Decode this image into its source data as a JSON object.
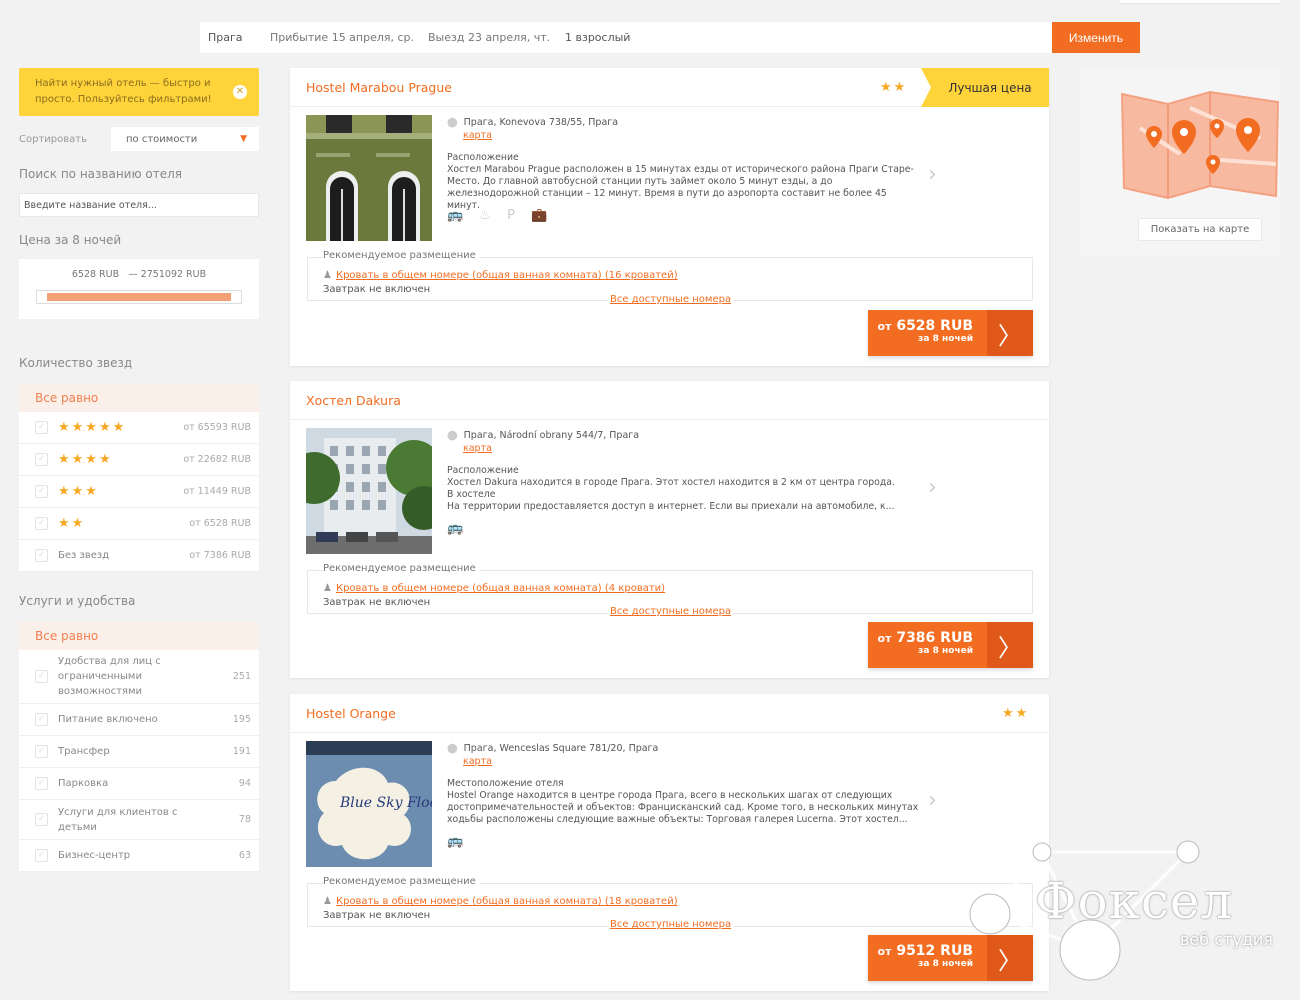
{
  "search": {
    "city": "Прага",
    "arrival": "Прибытие 15 апреля, ср.",
    "departure": "Выезд 23 апреля, чт.",
    "guests": "1 взрослый",
    "change_label": "Изменить"
  },
  "sidebar": {
    "hint": "Найти нужный отель — быстро и просто. Пользуйтесь фильтрами!",
    "hint_close": "✕",
    "sort_label": "Сортировать",
    "sort_value": "по стоимости",
    "name_search_title": "Поиск по названию отеля",
    "name_search_placeholder": "Введите название отеля...",
    "price_title": "Цена за 8 ночей",
    "price_min": "6528 RUB",
    "price_max": "— 2751092 RUB",
    "price_fill_fraction": 1.0,
    "stars_title": "Количество звезд",
    "stars_all": "Все равно",
    "stars_rows": [
      {
        "stars": "★★★★★",
        "value": "от 65593 RUB"
      },
      {
        "stars": "★★★★",
        "value": "от 22682 RUB"
      },
      {
        "stars": "★★★",
        "value": "от 11449 RUB"
      },
      {
        "stars": "★★",
        "value": "от 6528 RUB"
      },
      {
        "label": "Без звезд",
        "value": "от 7386 RUB"
      }
    ],
    "services_title": "Услуги и удобства",
    "services_all": "Все равно",
    "services": [
      {
        "label": "Удобства для лиц с ограниченными возможностями",
        "count": "251"
      },
      {
        "label": "Питание включено",
        "count": "195"
      },
      {
        "label": "Трансфер",
        "count": "191"
      },
      {
        "label": "Парковка",
        "count": "94"
      },
      {
        "label": "Услуги для клиентов с детьми",
        "count": "78"
      },
      {
        "label": "Бизнес-центр",
        "count": "63"
      }
    ]
  },
  "hotels": [
    {
      "name": "Hostel Marabou Prague",
      "stars": "★★",
      "badge": "Лучшая цена",
      "address": "Прага, Konevova 738/55, Прага",
      "map_link": "карта",
      "desc_title": "Расположение",
      "desc": "Хостел Marabou Prague расположен в 15 минутах езды от исторического района Праги Старе-Место. До главной автобусной станции путь займет около 5 минут езды, а до железнодорожной станции – 12 минут. Время в пути до аэропорта составит не более 45 минут.",
      "amenities": "🚌 ♨ P 💼",
      "rec_title": "Рекомендуемое размещение",
      "room": "Кровать в общем номере (общая ванная комната) (16 кроватей)",
      "breakfast": "Завтрак не включен",
      "all_rooms": "Все доступные номера",
      "price_prefix": "от",
      "price": "6528 RUB",
      "nights": "за 8 ночей",
      "arrow": "〉"
    },
    {
      "name": "Хостел Dakura",
      "address": "Прага, Národní obrany 544/7, Прага",
      "map_link": "карта",
      "desc_title": "Расположение",
      "desc": "Хостел Dakura находится в городе Прага. Этот хостел находится в 2 км от центра города.",
      "desc2": "В хостеле",
      "desc3": "На территории предоставляется доступ в интернет. Если вы приехали на автомобиле, к...",
      "amenities": "🚌",
      "rec_title": "Рекомендуемое размещение",
      "room": "Кровать в общем номере (общая ванная комната) (4 кровати)",
      "breakfast": "Завтрак не включен",
      "all_rooms": "Все доступные номера",
      "price_prefix": "от",
      "price": "7386 RUB",
      "nights": "за 8 ночей",
      "arrow": "〉"
    },
    {
      "name": "Hostel Orange",
      "stars": "★★",
      "address": "Прага, Wenceslas Square 781/20, Прага",
      "map_link": "карта",
      "desc_title": "Местоположение отеля",
      "desc": "Hostel Orange находится в центре города Прага, всего в нескольких шагах от следующих достопримечательностей и объектов: Францисканский сад. Кроме того, в нескольких минутах ходьбы расположены следующие важные объекты: Торговая галерея Lucerna. Этот хостел...",
      "amenities": "🚌",
      "rec_title": "Рекомендуемое размещение",
      "room": "Кровать в общем номере (общая ванная комната) (18 кроватей)",
      "breakfast": "Завтрак не включен",
      "all_rooms": "Все доступные номера",
      "price_prefix": "от",
      "price": "9512 RUB",
      "nights": "за 8 ночей",
      "arrow": "〉",
      "photo_text": "Blue Sky Floor Rooms"
    }
  ],
  "map": {
    "show_label": "Показать на карте"
  },
  "watermark": {
    "brand": "Фоксел",
    "sub": "веб студия"
  },
  "colors": {
    "accent": "#f26d21",
    "star": "#f7a823",
    "badge": "#ffd43b"
  }
}
